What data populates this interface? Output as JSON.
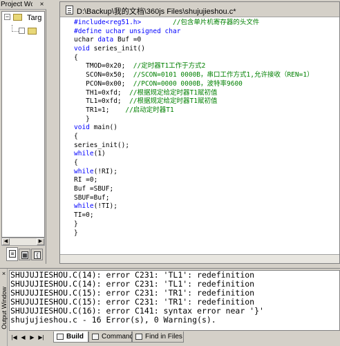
{
  "project_panel": {
    "title": "Project Wc",
    "close_glyph": "×",
    "tree": {
      "target_label": "Targ",
      "expand_glyph": "−"
    },
    "tabs": [
      {
        "icon": "files-icon"
      },
      {
        "icon": "books-icon"
      },
      {
        "icon": "functions-icon"
      }
    ]
  },
  "editor": {
    "title": "D:\\Backup\\我的文档\\360js Files\\shujujieshou.c*",
    "code_lines": [
      [
        {
          "t": "#include<reg51.h>",
          "c": "kw"
        },
        {
          "t": "        //包含单片机寄存器的头文件",
          "c": "cm"
        }
      ],
      [
        {
          "t": "#define uchar unsigned char",
          "c": "kw"
        }
      ],
      [
        {
          "t": "uchar ",
          "c": ""
        },
        {
          "t": "data",
          "c": "kw"
        },
        {
          "t": " Buf =0",
          "c": ""
        }
      ],
      [
        {
          "t": "void",
          "c": "kw"
        },
        {
          "t": " series_init()",
          "c": ""
        }
      ],
      [
        {
          "t": "{",
          "c": ""
        }
      ],
      [
        {
          "t": "   TMOD=0x20;  ",
          "c": ""
        },
        {
          "t": "//定时器T1工作于方式2",
          "c": "cm"
        }
      ],
      [
        {
          "t": "   SCON=0x50;  ",
          "c": ""
        },
        {
          "t": "//SCON=0101 0000B，串口工作方式1,允许接收（REN=1）",
          "c": "cm"
        }
      ],
      [
        {
          "t": "   PCON=0x00;  ",
          "c": ""
        },
        {
          "t": "//PCON=0000 0000B，波特率9600",
          "c": "cm"
        }
      ],
      [
        {
          "t": "   TH1=0xfd;  ",
          "c": ""
        },
        {
          "t": "//根据规定给定时器T1赋初值",
          "c": "cm"
        }
      ],
      [
        {
          "t": "   TL1=0xfd;  ",
          "c": ""
        },
        {
          "t": "//根据规定给定时器T1赋初值",
          "c": "cm"
        }
      ],
      [
        {
          "t": "   TR1=1;    ",
          "c": ""
        },
        {
          "t": "//启动定时器T1",
          "c": "cm"
        }
      ],
      [
        {
          "t": "   }",
          "c": ""
        }
      ],
      [
        {
          "t": "void",
          "c": "kw"
        },
        {
          "t": " main()",
          "c": ""
        }
      ],
      [
        {
          "t": "{",
          "c": ""
        }
      ],
      [
        {
          "t": "series_init();",
          "c": ""
        }
      ],
      [
        {
          "t": "while",
          "c": "kw"
        },
        {
          "t": "(1)",
          "c": ""
        }
      ],
      [
        {
          "t": "{",
          "c": ""
        }
      ],
      [
        {
          "t": "while",
          "c": "kw"
        },
        {
          "t": "(!RI);",
          "c": ""
        }
      ],
      [
        {
          "t": "RI =0;",
          "c": ""
        }
      ],
      [
        {
          "t": "Buf =SBUF;",
          "c": ""
        }
      ],
      [
        {
          "t": "SBUF=Buf;",
          "c": ""
        }
      ],
      [
        {
          "t": "while",
          "c": "kw"
        },
        {
          "t": "(!TI);",
          "c": ""
        }
      ],
      [
        {
          "t": "TI=0;",
          "c": ""
        }
      ],
      [
        {
          "t": "}",
          "c": ""
        }
      ],
      [
        {
          "t": "}",
          "c": ""
        }
      ]
    ]
  },
  "output": {
    "side_label": "Output Window",
    "close_glyph": "×",
    "lines": [
      "SHUJUJIESHOU.C(14): error C231: 'TL1': redefinition",
      "SHUJUJIESHOU.C(14): error C231: 'TL1': redefinition",
      "SHUJUJIESHOU.C(15): error C231: 'TR1': redefinition",
      "SHUJUJIESHOU.C(15): error C231: 'TR1': redefinition",
      "SHUJUJIESHOU.C(16): error C141: syntax error near '}'",
      "shujujieshou.c - 16 Error(s), 0 Warning(s)."
    ],
    "nav": [
      "|◀",
      "◀",
      "▶",
      "▶|"
    ],
    "tabs": [
      {
        "label": "Build",
        "active": true
      },
      {
        "label": "Command",
        "active": false
      },
      {
        "label": "Find in Files",
        "active": false
      }
    ]
  }
}
